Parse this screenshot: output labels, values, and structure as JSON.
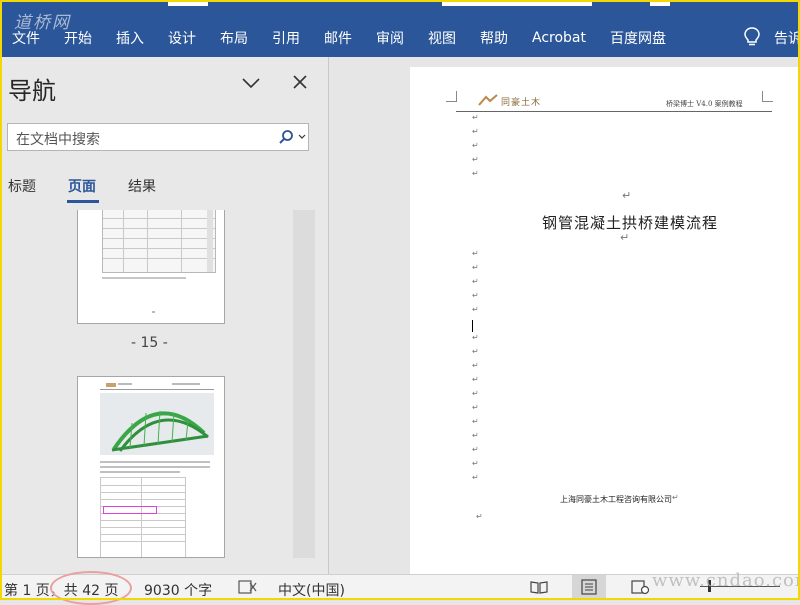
{
  "watermark_top": "道桥网",
  "watermark_bottom": "www.cndao.com",
  "ribbon": {
    "tabs": [
      "文件",
      "开始",
      "插入",
      "设计",
      "布局",
      "引用",
      "邮件",
      "审阅",
      "视图",
      "帮助",
      "Acrobat",
      "百度网盘"
    ],
    "tell_me": "告诉"
  },
  "nav": {
    "title": "导航",
    "search_placeholder": "在文档中搜索",
    "tabs": [
      {
        "label": "标题",
        "active": false
      },
      {
        "label": "页面",
        "active": true
      },
      {
        "label": "结果",
        "active": false
      }
    ],
    "page_labels": [
      "- 15 -"
    ]
  },
  "document": {
    "header_logo": "同豪土木",
    "header_right": "桥梁博士 V4.0 案例教程",
    "title": "钢管混凝土拱桥建模流程",
    "company": "上海同豪土木工程咨询有限公司",
    "para_mark": "↵"
  },
  "status": {
    "page": "第 1 页，共 42 页",
    "words": "9030 个字",
    "language": "中文(中国)"
  },
  "colors": {
    "ribbon": "#2b579a",
    "accent": "#2b579a",
    "frame": "#f2d800",
    "annotation_circle": "#e9a0a0"
  }
}
